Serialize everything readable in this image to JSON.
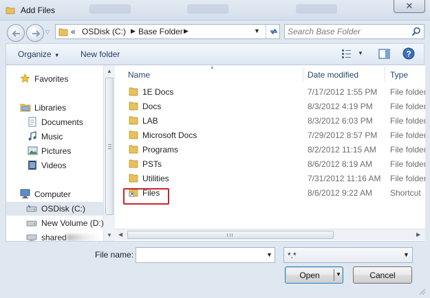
{
  "window": {
    "title": "Add Files",
    "close_glyph": "✕"
  },
  "address": {
    "prefix": "«",
    "crumbs": [
      "OSDisk (C:)",
      "Base Folder"
    ]
  },
  "search": {
    "placeholder": "Search Base Folder"
  },
  "toolbar": {
    "organize_label": "Organize",
    "new_folder_label": "New folder"
  },
  "nav": {
    "favorites": "Favorites",
    "libraries": "Libraries",
    "library_items": [
      "Documents",
      "Music",
      "Pictures",
      "Videos"
    ],
    "computer": "Computer",
    "drives": [
      "OSDisk (C:)",
      "New Volume (D:)",
      "shared"
    ]
  },
  "columns": {
    "name": "Name",
    "date": "Date modified",
    "type": "Type"
  },
  "files": [
    {
      "name": "1E Docs",
      "date": "7/17/2012 1:55 PM",
      "type": "File folder",
      "icon": "folder-icon"
    },
    {
      "name": "Docs",
      "date": "8/3/2012 4:19 PM",
      "type": "File folder",
      "icon": "folder-icon"
    },
    {
      "name": "LAB",
      "date": "8/3/2012 6:03 PM",
      "type": "File folder",
      "icon": "folder-icon"
    },
    {
      "name": "Microsoft Docs",
      "date": "7/29/2012 8:57 PM",
      "type": "File folder",
      "icon": "folder-icon"
    },
    {
      "name": "Programs",
      "date": "8/2/2012 11:15 AM",
      "type": "File folder",
      "icon": "folder-icon"
    },
    {
      "name": "PSTs",
      "date": "8/6/2012 8:19 AM",
      "type": "File folder",
      "icon": "folder-icon"
    },
    {
      "name": "Utilities",
      "date": "7/31/2012 11:16 AM",
      "type": "File folder",
      "icon": "folder-icon"
    },
    {
      "name": "Files",
      "date": "8/6/2012 9:22 AM",
      "type": "Shortcut",
      "icon": "shortcut-icon"
    }
  ],
  "bottom": {
    "filename_label": "File name:",
    "filename_value": "",
    "filter_value": "*.*",
    "open_label": "Open",
    "cancel_label": "Cancel"
  },
  "colors": {
    "highlight_box": "#c8262b",
    "chrome": "#dfe7f1",
    "toolbar_text": "#1e3a5f"
  }
}
